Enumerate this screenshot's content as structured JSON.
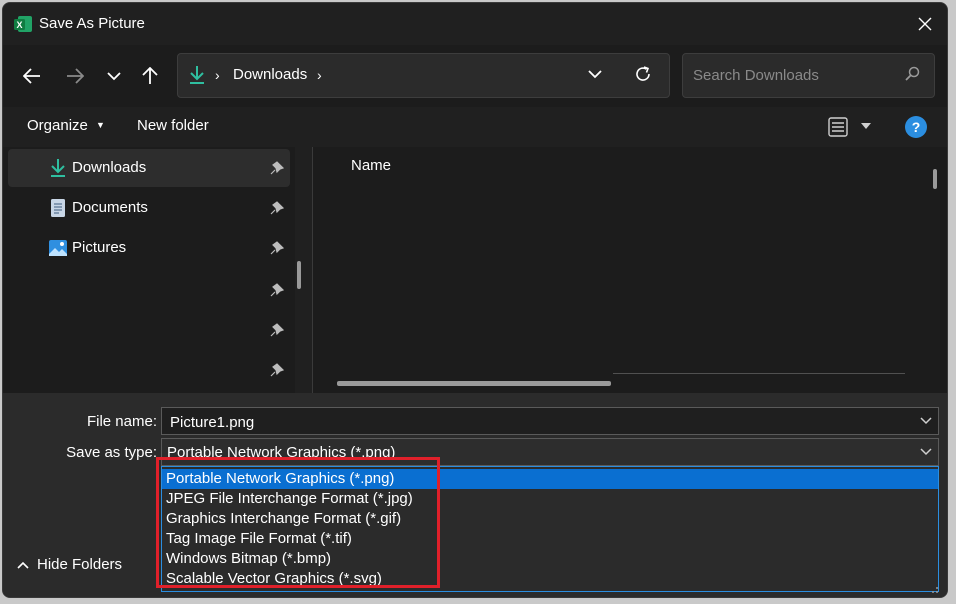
{
  "window": {
    "title": "Save As Picture",
    "app_icon": "excel-icon"
  },
  "nav": {
    "back": "back-arrow-icon",
    "forward": "forward-arrow-icon",
    "recent": "chevron-down-icon",
    "up": "up-arrow-icon"
  },
  "address": {
    "location_icon": "download-icon",
    "crumbs": [
      "Downloads"
    ]
  },
  "search": {
    "placeholder": "Search Downloads"
  },
  "commandbar": {
    "organize": "Organize",
    "new_folder": "New folder"
  },
  "sidebar": {
    "items": [
      {
        "label": "Downloads",
        "icon": "download-icon"
      },
      {
        "label": "Documents",
        "icon": "document-icon"
      },
      {
        "label": "Pictures",
        "icon": "pictures-icon"
      }
    ]
  },
  "content": {
    "column_name": "Name"
  },
  "form": {
    "file_name_label": "File name:",
    "file_name_value": "Picture1.png",
    "save_type_label": "Save as type:",
    "save_type_value": "Portable Network Graphics (*.png)",
    "options": [
      "Portable Network Graphics (*.png)",
      "JPEG File Interchange Format (*.jpg)",
      "Graphics Interchange Format (*.gif)",
      "Tag Image File Format (*.tif)",
      "Windows Bitmap (*.bmp)",
      "Scalable Vector Graphics (*.svg)"
    ],
    "hide_folders": "Hide Folders"
  },
  "colors": {
    "accent": "#0a6fd1",
    "highlight_box": "#e0202a",
    "download_icon": "#2fbfa0"
  }
}
